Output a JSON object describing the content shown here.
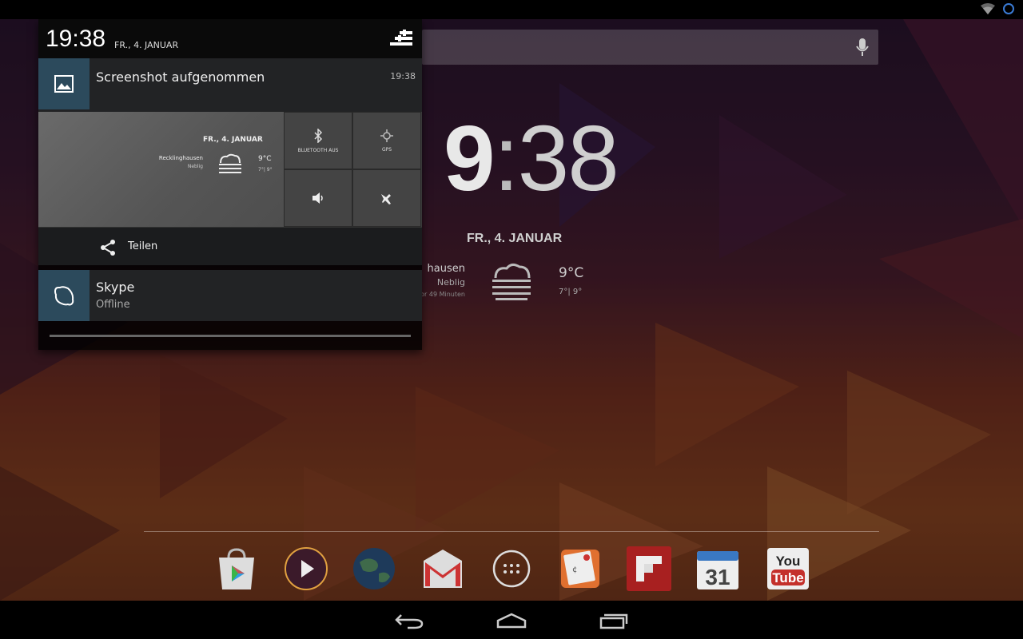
{
  "shade": {
    "time": "19:38",
    "date": "FR., 4. JANUAR",
    "settings_icon": "quick-settings-icon"
  },
  "notifications": {
    "screenshot": {
      "title": "Screenshot aufgenommen",
      "time": "19:38",
      "icon": "image-icon",
      "preview": {
        "date": "FR., 4. JANUAR",
        "place": "Recklinghausen",
        "condition": "Neblig",
        "temp": "9°C",
        "range": "7°| 9°",
        "tile_bluetooth": "BLUETOOTH AUS",
        "tile_gps": "GPS"
      },
      "share_label": "Teilen"
    },
    "skype": {
      "title": "Skype",
      "status": "Offline",
      "icon": "skype-icon"
    }
  },
  "home": {
    "clock_hour": "9",
    "clock_colon": ":",
    "clock_minutes": "38",
    "date": "FR., 4. JANUAR",
    "weather_place": "hausen",
    "weather_condition": "Neblig",
    "weather_updated": "vor 49 Minuten",
    "temp": "9°C",
    "range": "7°| 9°"
  },
  "dock": [
    {
      "name": "play-store",
      "icon": "play-store-icon"
    },
    {
      "name": "play-music",
      "icon": "play-music-icon"
    },
    {
      "name": "earth",
      "icon": "globe-icon"
    },
    {
      "name": "gmail",
      "icon": "gmail-icon"
    },
    {
      "name": "all-apps",
      "icon": "app-drawer-icon"
    },
    {
      "name": "notes",
      "icon": "notes-icon"
    },
    {
      "name": "flipboard",
      "icon": "flipboard-icon"
    },
    {
      "name": "calendar",
      "icon": "calendar-icon",
      "label": "31"
    },
    {
      "name": "youtube",
      "icon": "youtube-icon",
      "label_top": "You",
      "label_bottom": "Tube"
    }
  ],
  "colors": {
    "notif_icon_bg": "#2c4a5c",
    "shade_bg": "#222325"
  }
}
